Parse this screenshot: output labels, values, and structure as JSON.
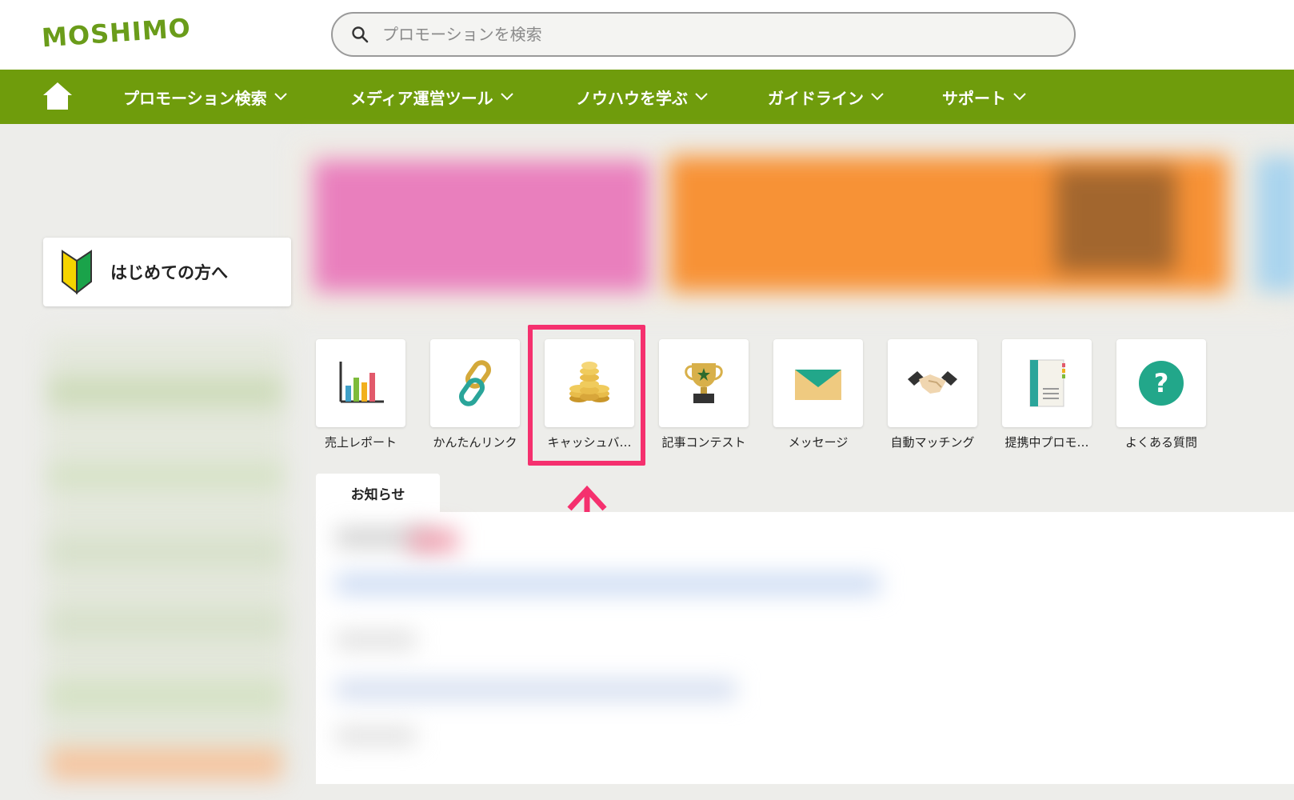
{
  "header": {
    "logo": "MOSHIMO",
    "search_placeholder": "プロモーションを検索"
  },
  "nav": {
    "home_icon": "home-icon",
    "items": [
      {
        "label": "プロモーション検索"
      },
      {
        "label": "メディア運営ツール"
      },
      {
        "label": "ノウハウを学ぶ"
      },
      {
        "label": "ガイドライン"
      },
      {
        "label": "サポート"
      }
    ]
  },
  "sidebar": {
    "beginner_label": "はじめての方へ"
  },
  "tools": [
    {
      "label": "売上レポート",
      "icon": "bar-chart-icon"
    },
    {
      "label": "かんたんリンク",
      "icon": "chain-link-icon"
    },
    {
      "label": "キャッシュバ…",
      "icon": "coins-icon"
    },
    {
      "label": "記事コンテスト",
      "icon": "trophy-icon"
    },
    {
      "label": "メッセージ",
      "icon": "envelope-icon"
    },
    {
      "label": "自動マッチング",
      "icon": "handshake-icon"
    },
    {
      "label": "提携中プロモ…",
      "icon": "promotion-book-icon"
    },
    {
      "label": "よくある質問",
      "icon": "question-icon"
    }
  ],
  "news": {
    "tab_label": "お知らせ"
  },
  "colors": {
    "brand_green": "#6f9c0c",
    "highlight_pink": "#f5306e"
  }
}
